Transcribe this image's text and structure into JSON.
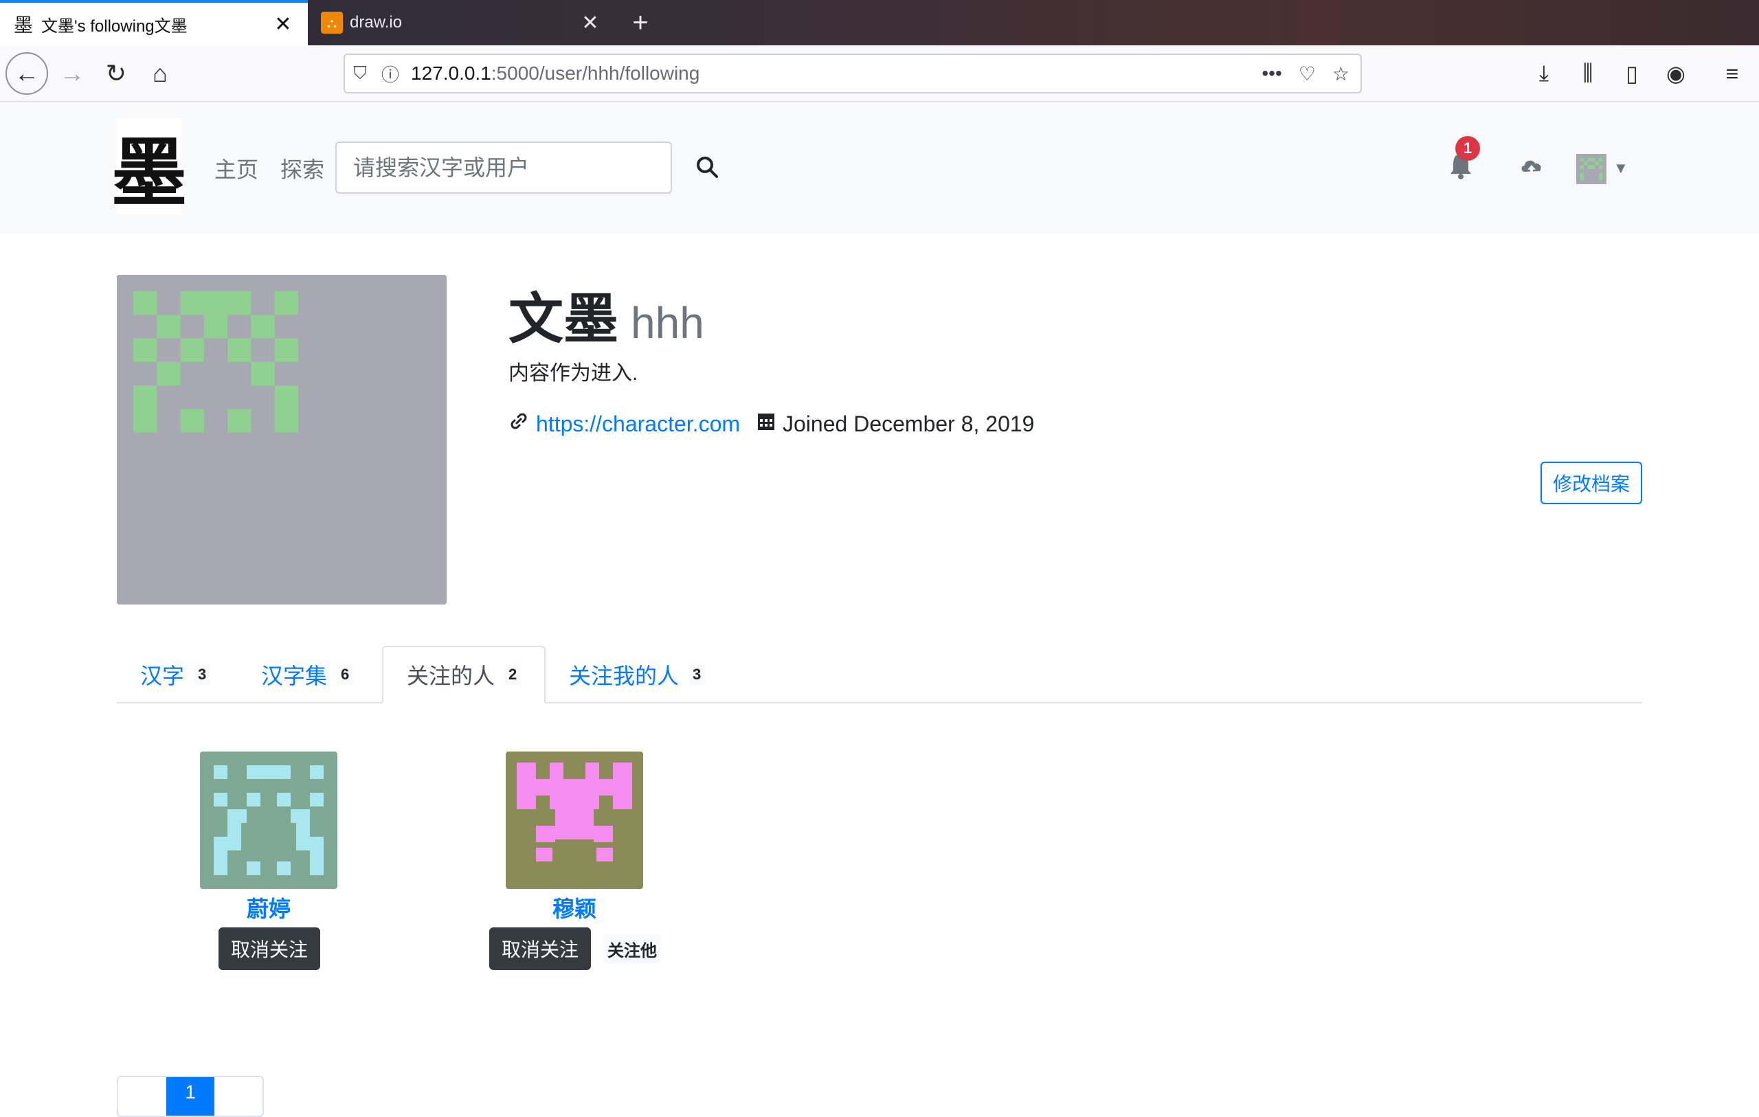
{
  "browser": {
    "tabs": [
      {
        "title": "文墨's following文墨",
        "favicon": "墨",
        "active": true
      },
      {
        "title": "draw.io",
        "favicon": "draw-icon",
        "active": false
      }
    ],
    "new_tab_label": "+",
    "url_host": "127.0.0.1",
    "url_path": ":5000/user/hhh/following"
  },
  "site": {
    "logo_char": "墨",
    "nav": {
      "home": "主页",
      "explore": "探索"
    },
    "search_placeholder": "请搜索汉字或用户",
    "notification_count": "1"
  },
  "profile": {
    "display_name": "文墨",
    "username": "hhh",
    "bio": "内容作为进入.",
    "website": "https://character.com",
    "joined": "Joined December 8, 2019",
    "edit_label": "修改档案"
  },
  "tabs": [
    {
      "label": "汉字",
      "count": "3"
    },
    {
      "label": "汉字集",
      "count": "6"
    },
    {
      "label": "关注的人",
      "count": "2"
    },
    {
      "label": "关注我的人",
      "count": "3"
    }
  ],
  "following": [
    {
      "name": "蔚婷",
      "unfollow_label": "取消关注",
      "follows_back": "",
      "bg": "#7fa894",
      "fg": "#a8e6f0"
    },
    {
      "name": "穆颖",
      "unfollow_label": "取消关注",
      "follows_back": "关注他",
      "bg": "#8b8b58",
      "fg": "#f58cf0"
    }
  ],
  "pagination": {
    "current": "1"
  },
  "colors": {
    "primary": "#007bff",
    "avatar_bg": "#a8a8b2",
    "avatar_fg": "#90d090"
  }
}
